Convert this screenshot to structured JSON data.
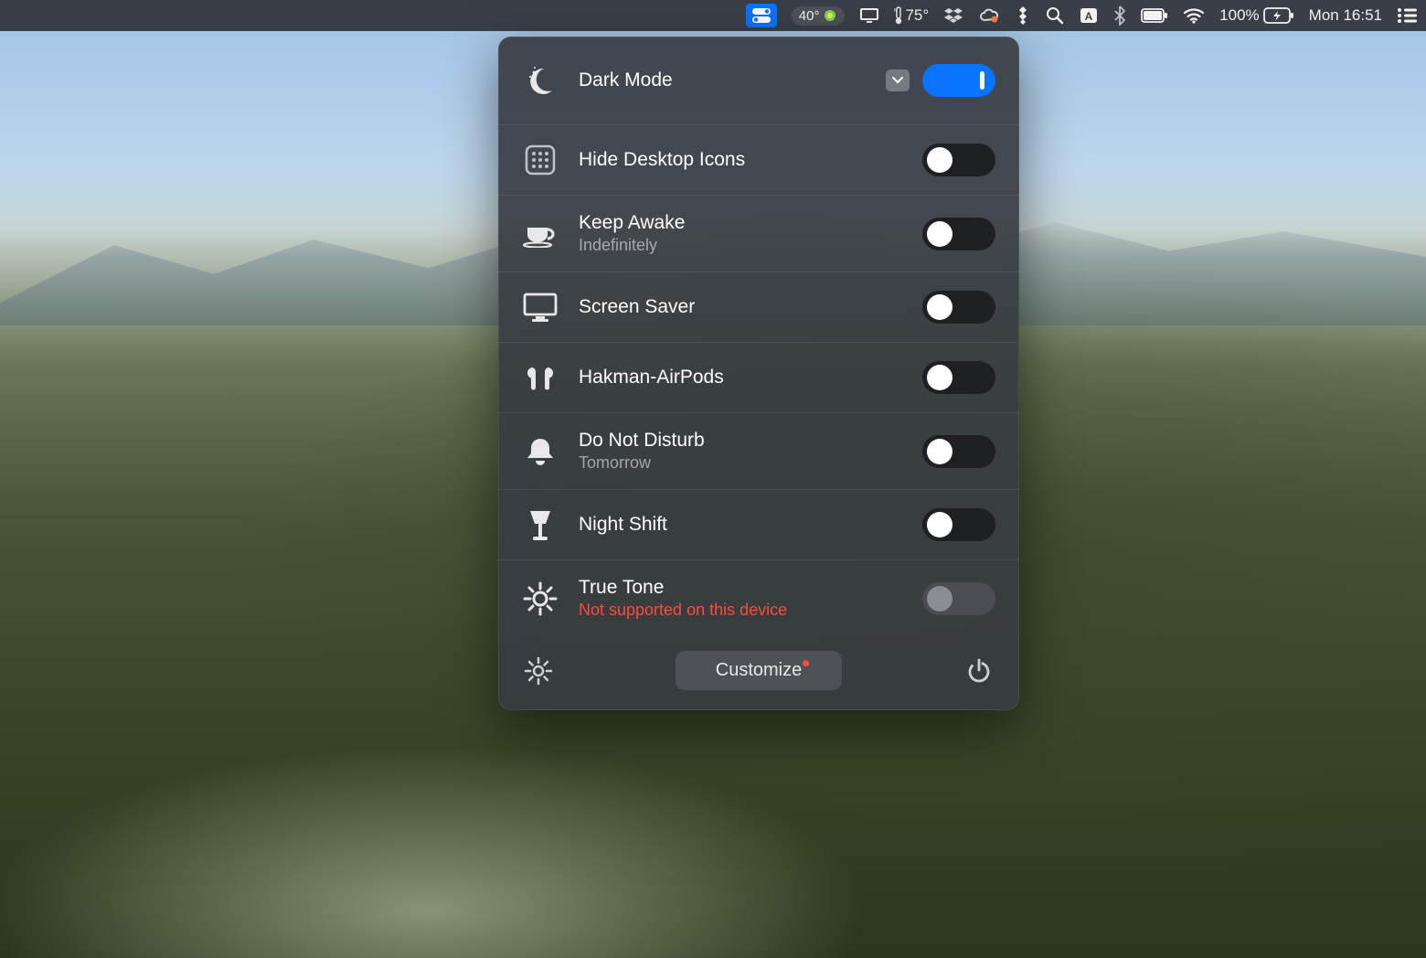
{
  "menubar": {
    "weather1": "40°",
    "temp2": "75°",
    "battery_pct": "100%",
    "clock": "Mon 16:51"
  },
  "panel": {
    "rows": [
      {
        "label": "Dark Mode",
        "sub": "",
        "toggle": "on",
        "has_dropdown": true,
        "icon": "moon"
      },
      {
        "label": "Hide Desktop Icons",
        "sub": "",
        "toggle": "off",
        "icon": "grid"
      },
      {
        "label": "Keep Awake",
        "sub": "Indefinitely",
        "toggle": "off",
        "icon": "coffee"
      },
      {
        "label": "Screen Saver",
        "sub": "",
        "toggle": "off",
        "icon": "monitor"
      },
      {
        "label": "Hakman-AirPods",
        "sub": "",
        "toggle": "off",
        "icon": "airpods"
      },
      {
        "label": "Do Not Disturb",
        "sub": "Tomorrow",
        "toggle": "off",
        "icon": "bell"
      },
      {
        "label": "Night Shift",
        "sub": "",
        "toggle": "off",
        "icon": "lamp"
      },
      {
        "label": "True Tone",
        "sub": "Not supported on this device",
        "sub_error": true,
        "toggle": "disabled",
        "icon": "sun"
      }
    ],
    "footer": {
      "customize_label": "Customize"
    }
  }
}
